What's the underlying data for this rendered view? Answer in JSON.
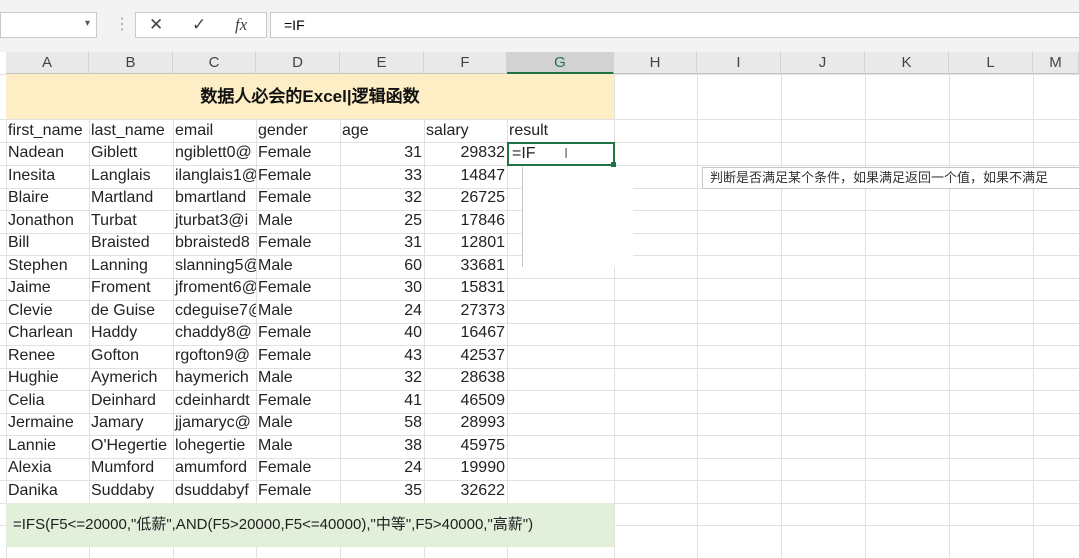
{
  "formula_bar": {
    "name_box": "",
    "cancel_icon": "✕",
    "confirm_icon": "✓",
    "fx_label": "fx",
    "formula": "=IF"
  },
  "columns": [
    "A",
    "B",
    "C",
    "D",
    "E",
    "F",
    "G",
    "H",
    "I",
    "J",
    "K",
    "L",
    "M"
  ],
  "selected_column": "G",
  "sheet": {
    "title": "数据人必会的Excel|逻辑函数",
    "headers": [
      "first_name",
      "last_name",
      "email",
      "gender",
      "age",
      "salary",
      "result"
    ],
    "rows": [
      [
        "Nadean",
        "Giblett",
        "ngiblett0@",
        "Female",
        "31",
        "29832"
      ],
      [
        "Inesita",
        "Langlais",
        "ilanglais1@",
        "Female",
        "33",
        "14847"
      ],
      [
        "Blaire",
        "Martland",
        "bmartland",
        "Female",
        "32",
        "26725"
      ],
      [
        "Jonathon",
        "Turbat",
        "jturbat3@i",
        "Male",
        "25",
        "17846"
      ],
      [
        "Bill",
        "Braisted",
        "bbraisted8",
        "Female",
        "31",
        "12801"
      ],
      [
        "Stephen",
        "Lanning",
        "slanning5@",
        "Male",
        "60",
        "33681"
      ],
      [
        "Jaime",
        "Froment",
        "jfroment6@",
        "Female",
        "30",
        "15831"
      ],
      [
        "Clevie",
        "de Guise",
        "cdeguise7@",
        "Male",
        "24",
        "27373"
      ],
      [
        "Charlean",
        "Haddy",
        "chaddy8@",
        "Female",
        "40",
        "16467"
      ],
      [
        "Renee",
        "Gofton",
        "rgofton9@",
        "Female",
        "43",
        "42537"
      ],
      [
        "Hughie",
        "Aymerich",
        "haymerich",
        "Male",
        "32",
        "28638"
      ],
      [
        "Celia",
        "Deinhard",
        "cdeinhardt",
        "Female",
        "41",
        "46509"
      ],
      [
        "Jermaine",
        "Jamary",
        "jjamaryc@",
        "Male",
        "58",
        "28993"
      ],
      [
        "Lannie",
        "O'Hegertie",
        "lohegertie",
        "Male",
        "38",
        "45975"
      ],
      [
        "Alexia",
        "Mumford",
        "amumford",
        "Female",
        "24",
        "19990"
      ],
      [
        "Danika",
        "Suddaby",
        "dsuddabyf",
        "Female",
        "35",
        "32622"
      ]
    ],
    "active_cell_text": "=IF",
    "tooltip": "判断是否满足某个条件，如果满足返回一个值，如果不满足",
    "formula_note": "=IFS(F5<=20000,\"低薪\",AND(F5>20000,F5<=40000),\"中等\",F5>40000,\"高薪\")"
  }
}
